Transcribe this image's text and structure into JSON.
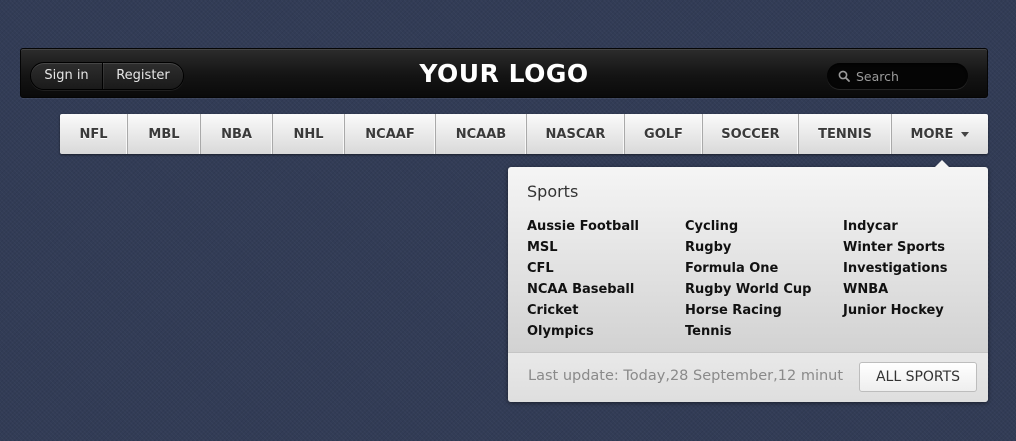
{
  "header": {
    "signin_label": "Sign in",
    "register_label": "Register",
    "logo_text": "YOUR LOGO",
    "search": {
      "placeholder": "Search",
      "value": ""
    }
  },
  "nav": {
    "items": [
      {
        "label": "NFL"
      },
      {
        "label": "MBL"
      },
      {
        "label": "NBA"
      },
      {
        "label": "NHL"
      },
      {
        "label": "NCAAF"
      },
      {
        "label": "NCAAB"
      },
      {
        "label": "NASCAR"
      },
      {
        "label": "GOLF"
      },
      {
        "label": "SOCCER"
      },
      {
        "label": "TENNIS"
      },
      {
        "label": "MORE"
      }
    ]
  },
  "dropdown": {
    "title": "Sports",
    "columns": [
      [
        "Aussie Football",
        "MSL",
        "CFL",
        "NCAA Baseball",
        "Cricket",
        "Olympics"
      ],
      [
        "Cycling",
        "Rugby",
        "Formula One",
        "Rugby World Cup",
        "Horse Racing",
        "Tennis"
      ],
      [
        "Indycar",
        "Winter Sports",
        "Investigations",
        "WNBA",
        "Junior Hockey"
      ]
    ],
    "last_update": "Last update: Today,28 September,12 minut",
    "all_sports_label": "ALL SPORTS"
  },
  "icons": {
    "search": "search-icon",
    "more_caret": "caret-down-icon"
  }
}
